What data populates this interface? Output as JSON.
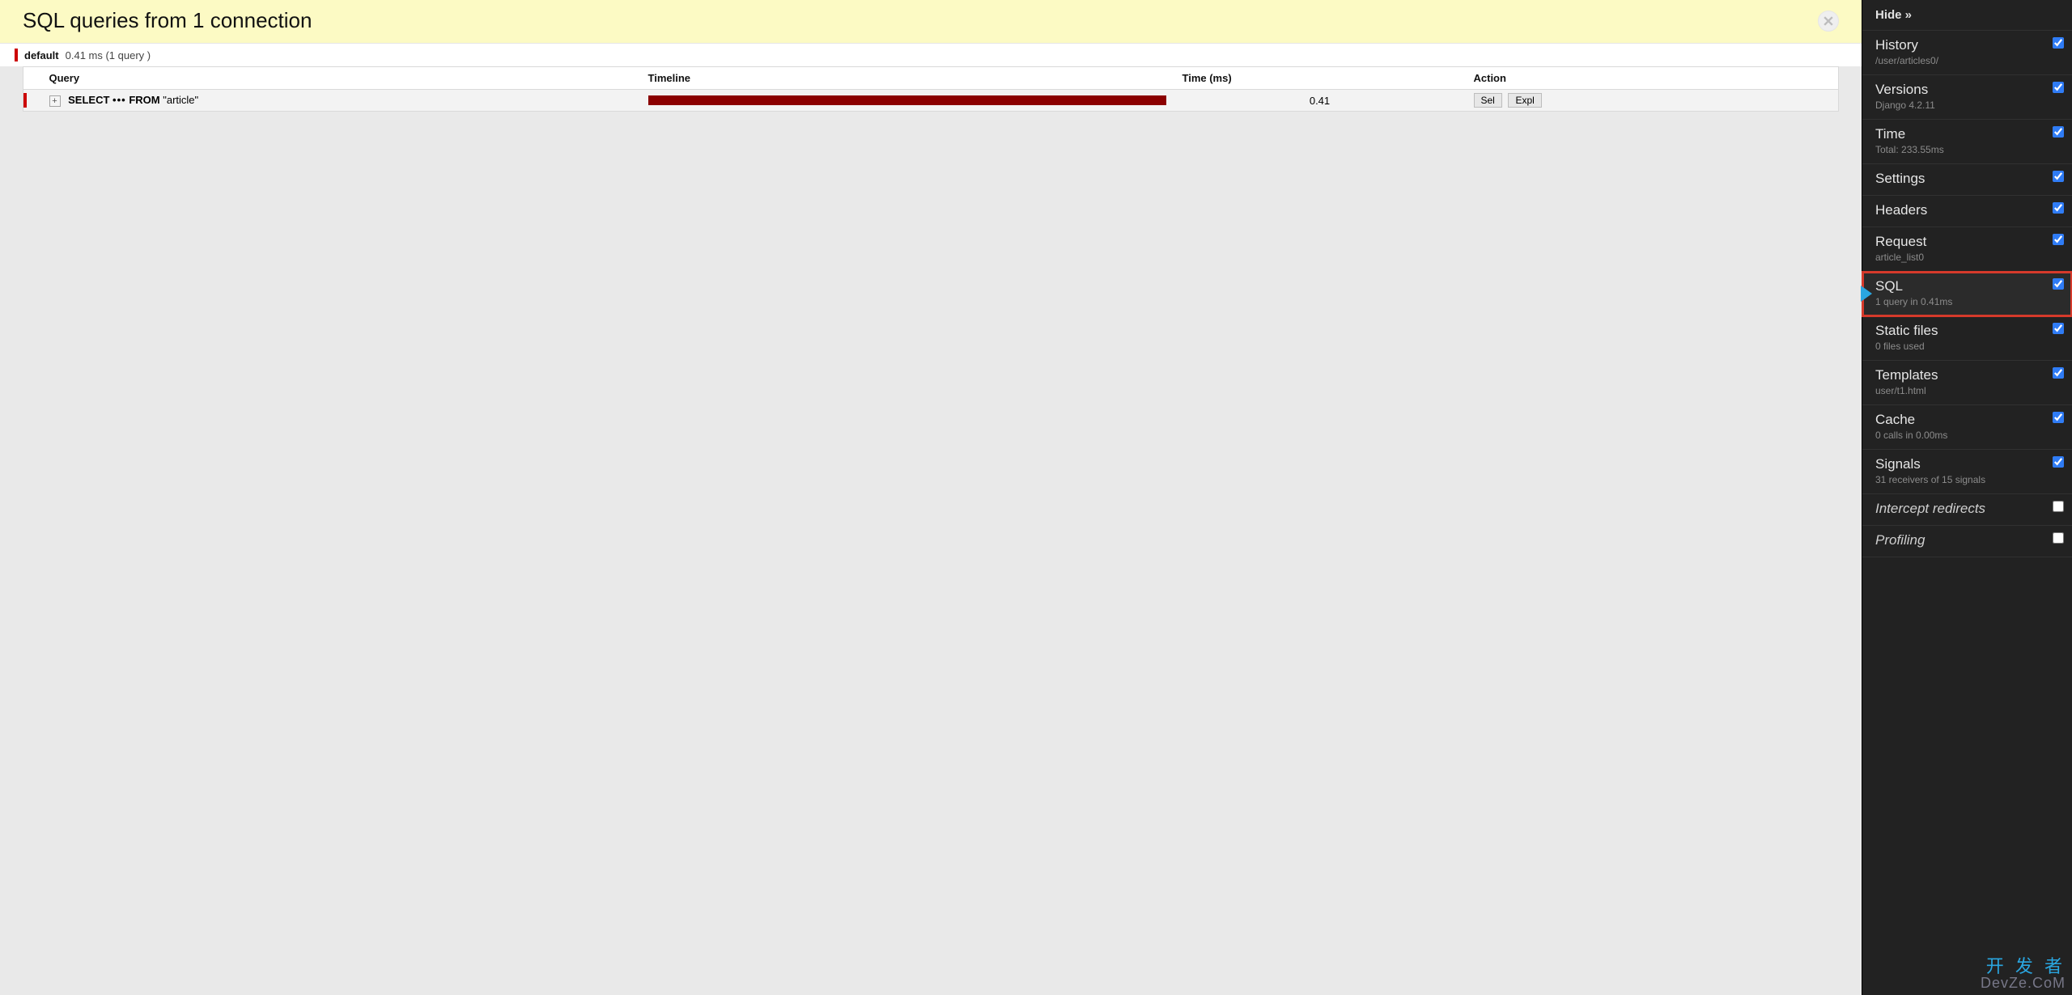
{
  "title": "SQL queries from 1 connection",
  "summary": {
    "db": "default",
    "detail": "0.41 ms (1 query )"
  },
  "table": {
    "headers": {
      "query": "Query",
      "timeline": "Timeline",
      "time": "Time (ms)",
      "action": "Action"
    },
    "row": {
      "expand": "+",
      "sql_prefix1": "SELECT",
      "sql_dots": "•••",
      "sql_prefix2": "FROM",
      "sql_table": "\"article\"",
      "time": "0.41",
      "btn_sel": "Sel",
      "btn_expl": "Expl"
    }
  },
  "sidebar": {
    "hide": "Hide »",
    "panels": [
      {
        "key": "history",
        "title": "History",
        "sub": "/user/articles0/",
        "checked": true
      },
      {
        "key": "versions",
        "title": "Versions",
        "sub": "Django 4.2.11",
        "checked": true
      },
      {
        "key": "time",
        "title": "Time",
        "sub": "Total: 233.55ms",
        "checked": true
      },
      {
        "key": "settings",
        "title": "Settings",
        "sub": "",
        "checked": true
      },
      {
        "key": "headers",
        "title": "Headers",
        "sub": "",
        "checked": true
      },
      {
        "key": "request",
        "title": "Request",
        "sub": "article_list0",
        "checked": true
      },
      {
        "key": "sql",
        "title": "SQL",
        "sub": "1 query in 0.41ms",
        "checked": true,
        "active": true
      },
      {
        "key": "static",
        "title": "Static files",
        "sub": "0 files used",
        "checked": true
      },
      {
        "key": "templates",
        "title": "Templates",
        "sub": "user/t1.html",
        "checked": true
      },
      {
        "key": "cache",
        "title": "Cache",
        "sub": "0 calls in 0.00ms",
        "checked": true
      },
      {
        "key": "signals",
        "title": "Signals",
        "sub": "31 receivers of 15 signals",
        "checked": true
      },
      {
        "key": "redirects",
        "title": "Intercept redirects",
        "sub": "",
        "checked": false,
        "italic": true
      },
      {
        "key": "profiling",
        "title": "Profiling",
        "sub": "",
        "checked": false,
        "italic": true
      }
    ]
  },
  "watermark": {
    "line1": "开 发 者",
    "line2": "DevZe.CoM"
  }
}
